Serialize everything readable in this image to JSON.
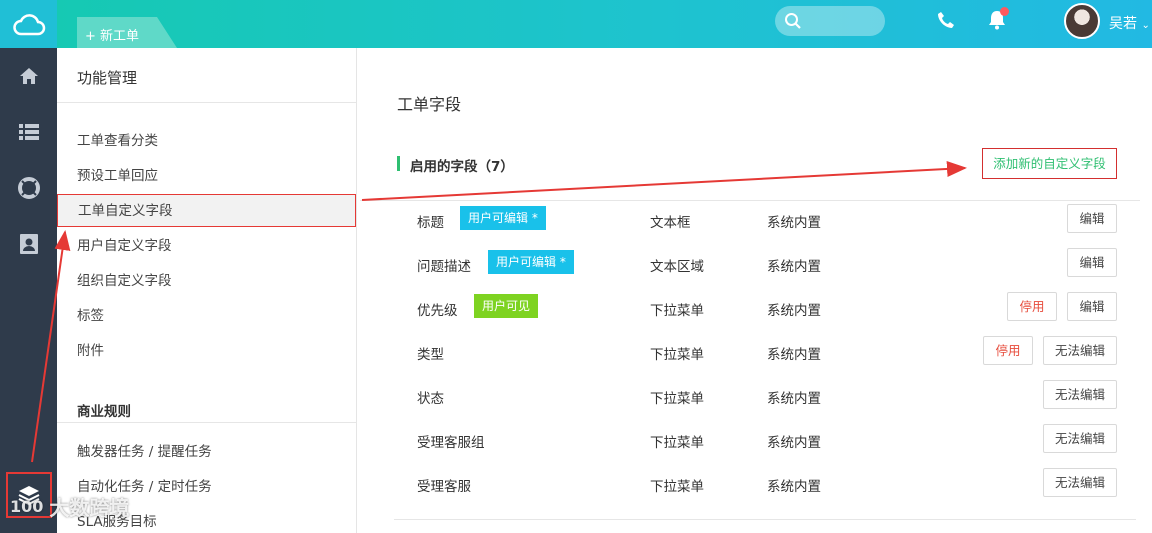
{
  "colors": {
    "rail": "#2f3b4b",
    "accent_teal": "#1ec3cf",
    "tag_blue": "#19c1ea",
    "tag_green": "#7ed321",
    "highlight_red": "#e53935",
    "section_green": "#2fbf71"
  },
  "topbar": {
    "new_ticket_label": "+ 新工单",
    "user_name": "吴若",
    "icons": [
      "cloud-logo-icon",
      "search-icon",
      "phone-icon",
      "bell-icon",
      "chevron-down-icon"
    ]
  },
  "rail": {
    "icons": [
      "home-icon",
      "list-icon",
      "lifebuoy-icon",
      "contact-card-icon",
      "layers-icon"
    ]
  },
  "sidebar": {
    "title": "功能管理",
    "items": [
      {
        "label": "工单查看分类"
      },
      {
        "label": "预设工单回应"
      },
      {
        "label": "工单自定义字段"
      },
      {
        "label": "用户自定义字段"
      },
      {
        "label": "组织自定义字段"
      },
      {
        "label": "标签"
      },
      {
        "label": "附件"
      }
    ],
    "section_title": "商业规则",
    "section_items": [
      {
        "label": "触发器任务 / 提醒任务"
      },
      {
        "label": "自动化任务 / 定时任务"
      },
      {
        "label": "SLA服务目标"
      }
    ]
  },
  "main": {
    "page_title": "工单字段",
    "section_title": "启用的字段（7）",
    "add_button": "添加新的自定义字段",
    "fields": [
      {
        "name": "标题",
        "tag": "用户可编辑 *",
        "type": "文本框",
        "source": "系统内置",
        "buttons": [
          "编辑"
        ]
      },
      {
        "name": "问题描述",
        "tag": "用户可编辑 *",
        "type": "文本区域",
        "source": "系统内置",
        "buttons": [
          "编辑"
        ]
      },
      {
        "name": "优先级",
        "tag": "用户可见",
        "type": "下拉菜单",
        "source": "系统内置",
        "buttons": [
          "停用",
          "编辑"
        ]
      },
      {
        "name": "类型",
        "tag": "",
        "type": "下拉菜单",
        "source": "系统内置",
        "buttons": [
          "停用",
          "无法编辑"
        ]
      },
      {
        "name": "状态",
        "tag": "",
        "type": "下拉菜单",
        "source": "系统内置",
        "buttons": [
          "无法编辑"
        ]
      },
      {
        "name": "受理客服组",
        "tag": "",
        "type": "下拉菜单",
        "source": "系统内置",
        "buttons": [
          "无法编辑"
        ]
      },
      {
        "name": "受理客服",
        "tag": "",
        "type": "下拉菜单",
        "source": "系统内置",
        "buttons": [
          "无法编辑"
        ]
      }
    ]
  },
  "watermark": {
    "text": "大数跨境",
    "logo_text": "100"
  }
}
